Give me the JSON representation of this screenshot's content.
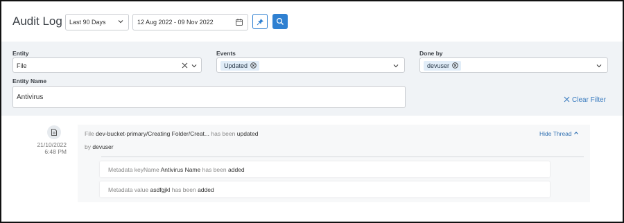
{
  "header": {
    "title": "Audit Log",
    "period": "Last 90 Days",
    "date_range": "12 Aug 2022 - 09 Nov 2022"
  },
  "filters": {
    "entity_label": "Entity",
    "entity_value": "File",
    "events_label": "Events",
    "events_chip": "Updated",
    "doneby_label": "Done by",
    "doneby_chip": "devuser",
    "entity_name_label": "Entity Name",
    "entity_name_value": "Antivirus",
    "clear_label": "Clear Filter"
  },
  "log": {
    "date": "21/10/2022",
    "time": "6:48 PM",
    "entity_type": "File",
    "entity_path": "dev-bucket-primary/Creating Folder/Creat...",
    "has_been": "has been",
    "action": "updated",
    "by_label": "by",
    "user": "devuser",
    "hide_thread": "Hide Thread",
    "sub_items": [
      {
        "prefix": "Metadata keyName",
        "value": "Antivirus Name",
        "has_been": "has been",
        "action": "added"
      },
      {
        "prefix": "Metadata value",
        "value": "asdfgjkl",
        "has_been": "has been",
        "action": "added"
      }
    ]
  },
  "colors": {
    "accent": "#2f80d1",
    "filter_bg": "#f0f3f6",
    "chip_bg": "#e1edf8",
    "link": "#3a7bbf"
  },
  "icons": [
    "chevron-down-icon",
    "calendar-icon",
    "pin-icon",
    "search-icon",
    "close-icon",
    "document-icon",
    "chevron-up-icon"
  ]
}
